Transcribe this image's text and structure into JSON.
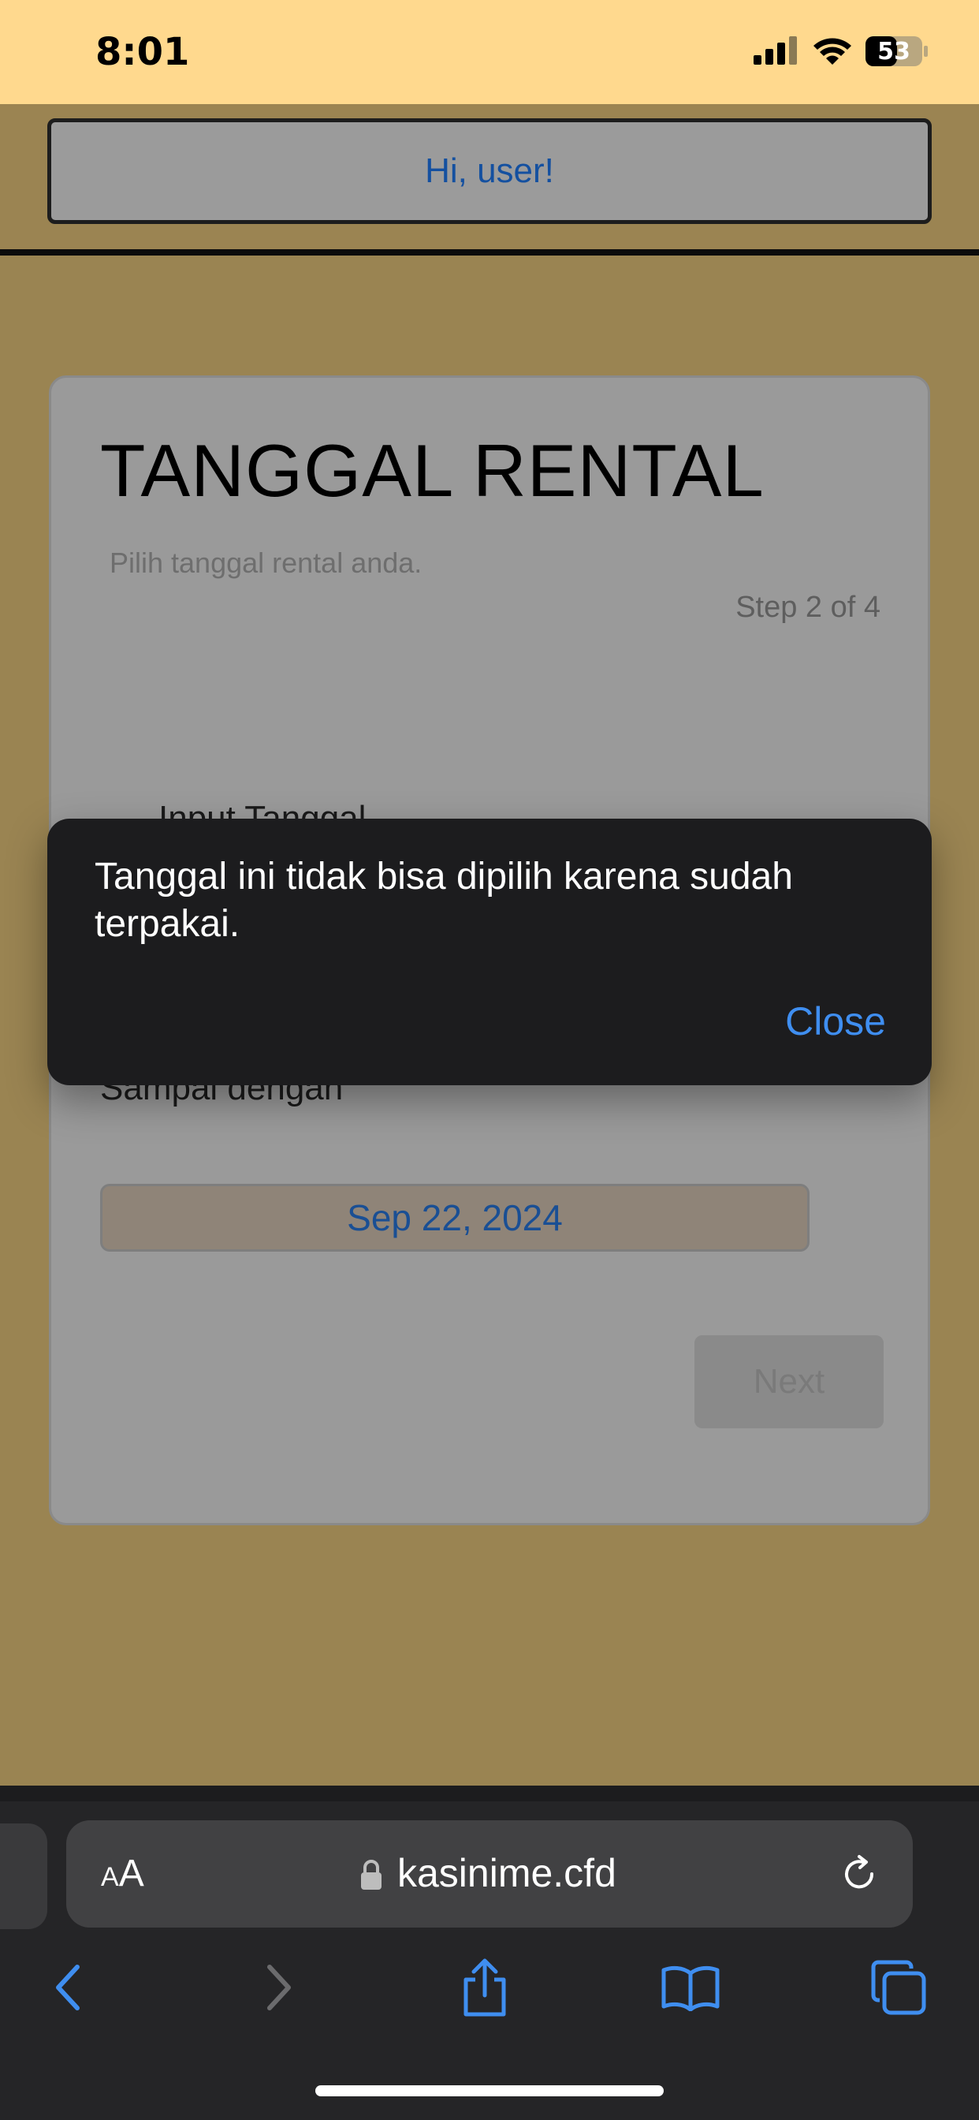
{
  "status_bar": {
    "time": "8:01",
    "battery_level": "53",
    "icons": [
      "cellular-signal-icon",
      "wifi-icon",
      "battery-icon"
    ]
  },
  "header": {
    "greeting": "Hi, user!"
  },
  "card": {
    "title": "TANGGAL RENTAL",
    "subtitle": "Pilih tanggal rental anda.",
    "step": "Step 2 of 4",
    "input_label": "Input Tanggal",
    "until_label": "Sampai dengan",
    "end_date": "Sep 22, 2024",
    "next_label": "Next"
  },
  "toast": {
    "message": "Tanggal ini tidak bisa dipilih karena sudah terpakai.",
    "close_label": "Close"
  },
  "browser": {
    "text_size_label_small": "A",
    "text_size_label_large": "A",
    "url": "kasinime.cfd",
    "nav_icons": [
      "back-icon",
      "forward-icon",
      "share-icon",
      "bookmarks-icon",
      "tabs-icon"
    ]
  },
  "colors": {
    "status_bar_bg": "#ffd98e",
    "page_bg_dimmed": "#9a8452",
    "toast_bg": "#1c1c1e",
    "accent_blue": "#3f8ef0"
  }
}
